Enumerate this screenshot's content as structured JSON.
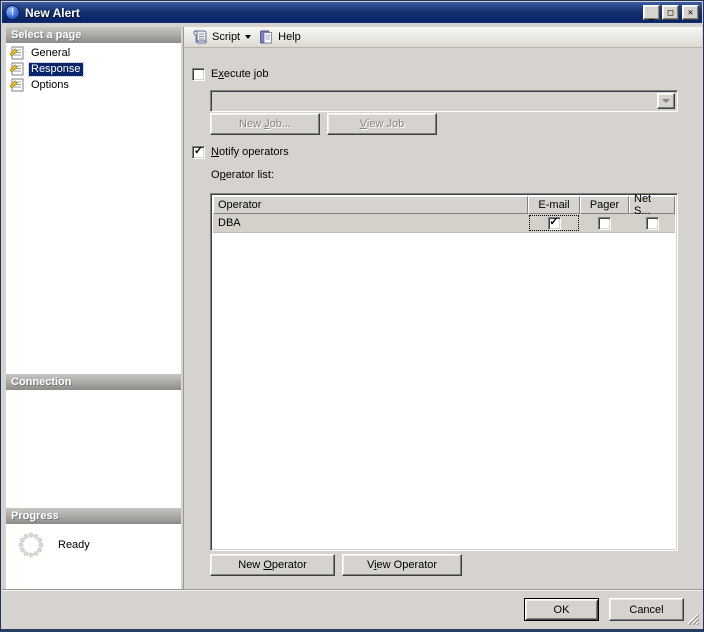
{
  "window": {
    "title": "New Alert",
    "minimize_glyph": "_",
    "maximize_glyph": "□",
    "close_glyph": "✕"
  },
  "sidebar": {
    "select_page_header": "Select a page",
    "pages": [
      {
        "label": "General"
      },
      {
        "label": "Response"
      },
      {
        "label": "Options"
      }
    ],
    "selected_page": "Response",
    "connection_header": "Connection",
    "progress_header": "Progress",
    "progress_status": "Ready"
  },
  "toolbar": {
    "script_label": "Script",
    "help_label": "Help"
  },
  "main": {
    "execute_job": {
      "text": "Execute job",
      "underline_index": 1,
      "check": ""
    },
    "job_combo": {
      "value": "",
      "disabled": true
    },
    "new_job": {
      "text": "New Job...",
      "underline_index": 4,
      "disabled": true
    },
    "view_job": {
      "text": "View Job",
      "underline_index": 0,
      "disabled": true
    },
    "notify_operators": {
      "text": "Notify operators",
      "underline_index": 0,
      "check": "✓"
    },
    "operator_list": {
      "text": "Operator list:",
      "underline_index": 1
    },
    "table": {
      "columns": [
        "Operator",
        "E-mail",
        "Pager",
        "Net S..."
      ],
      "rows": [
        {
          "operator": "DBA",
          "email_check": "✓",
          "pager_check": "",
          "net_send_check": ""
        }
      ]
    },
    "new_operator": {
      "text": "New Operator",
      "underline_index": 4
    },
    "view_operator": {
      "text": "View Operator",
      "underline_index": 1
    }
  },
  "footer": {
    "ok_label": "OK",
    "cancel_label": "Cancel"
  },
  "colors": {
    "titlebar": "#0a246a",
    "dialog_bg": "#d6d3ce",
    "selection_bg": "#0a246a",
    "selection_fg": "#ffffff",
    "row_bg": "#d4d1cb",
    "disabled_text": "#8a867f"
  }
}
